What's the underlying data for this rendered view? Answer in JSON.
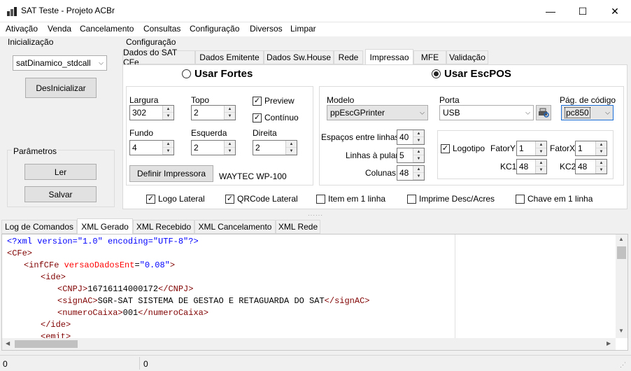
{
  "window": {
    "title": "SAT Teste - Projeto ACBr",
    "minimize": "—",
    "maximize": "☐",
    "close": "✕"
  },
  "menu": [
    "Ativação",
    "Venda",
    "Cancelamento",
    "Consultas",
    "Configuração",
    "Diversos",
    "Limpar"
  ],
  "init": {
    "title": "Inicialização",
    "lib_value": "satDinamico_stdcall",
    "deinit_label": "DesInicializar",
    "params_title": "Parâmetros",
    "read_label": "Ler",
    "save_label": "Salvar"
  },
  "config": {
    "title": "Configuração",
    "tabs": [
      "Dados do SAT CFe",
      "Dados Emitente",
      "Dados Sw.House",
      "Rede",
      "Impressao",
      "MFE",
      "Validação"
    ],
    "active_tab": "Impressao",
    "radio_fortes": "Usar Fortes",
    "radio_escpos": "Usar EscPOS",
    "selected": "Usar EscPOS",
    "fortes": {
      "largura_label": "Largura",
      "largura": "302",
      "topo_label": "Topo",
      "topo": "2",
      "fundo_label": "Fundo",
      "fundo": "4",
      "esquerda_label": "Esquerda",
      "esquerda": "2",
      "direita_label": "Direita",
      "direita": "2",
      "preview_label": "Preview",
      "preview": true,
      "continuo_label": "Contínuo",
      "continuo": true,
      "define_printer_label": "Definir Impressora",
      "printer_name": "WAYTEC WP-100"
    },
    "escpos": {
      "modelo_label": "Modelo",
      "modelo": "ppEscGPrinter",
      "porta_label": "Porta",
      "porta": "USB",
      "codepage_label": "Pág. de código",
      "codepage": "pc850",
      "espacos_label": "Espaços entre linhas",
      "espacos": "40",
      "linhas_pular_label": "Linhas à pular",
      "linhas_pular": "5",
      "colunas_label": "Colunas",
      "colunas": "48",
      "logotipo_label": "Logotipo",
      "logotipo": true,
      "fatory_label": "FatorY",
      "fatory": "1",
      "fatorx_label": "FatorX",
      "fatorx": "1",
      "kc1_label": "KC1",
      "kc1": "48",
      "kc2_label": "KC2",
      "kc2": "48"
    },
    "bottom_checks": [
      {
        "label": "Logo Lateral",
        "checked": true
      },
      {
        "label": "QRCode Lateral",
        "checked": true
      },
      {
        "label": "Item em 1 linha",
        "checked": false
      },
      {
        "label": "Imprime Desc/Acres",
        "checked": false
      },
      {
        "label": "Chave em 1 linha",
        "checked": false
      }
    ]
  },
  "log_tabs": [
    "Log de Comandos",
    "XML Gerado",
    "XML Recebido",
    "XML Cancelamento",
    "XML Rede"
  ],
  "active_log_tab": "XML Gerado",
  "xml_lines": [
    {
      "indent": 0,
      "parts": [
        [
          "pi",
          "<?xml version=\"1.0\" encoding=\"UTF-8\"?>"
        ]
      ]
    },
    {
      "indent": 0,
      "parts": [
        [
          "tg",
          "<CFe>"
        ]
      ]
    },
    {
      "indent": 1,
      "parts": [
        [
          "tg",
          "<infCFe "
        ],
        [
          "at",
          "versaoDadosEnt"
        ],
        [
          "tx",
          "="
        ],
        [
          "av",
          "\"0.08\""
        ],
        [
          "tg",
          ">"
        ]
      ]
    },
    {
      "indent": 2,
      "parts": [
        [
          "tg",
          "<ide>"
        ]
      ]
    },
    {
      "indent": 3,
      "parts": [
        [
          "tg",
          "<CNPJ>"
        ],
        [
          "tx",
          "16716114000172"
        ],
        [
          "tg",
          "</CNPJ>"
        ]
      ]
    },
    {
      "indent": 3,
      "parts": [
        [
          "tg",
          "<signAC>"
        ],
        [
          "tx",
          "SGR-SAT SISTEMA DE GESTAO E RETAGUARDA DO SAT"
        ],
        [
          "tg",
          "</signAC>"
        ]
      ]
    },
    {
      "indent": 3,
      "parts": [
        [
          "tg",
          "<numeroCaixa>"
        ],
        [
          "tx",
          "001"
        ],
        [
          "tg",
          "</numeroCaixa>"
        ]
      ]
    },
    {
      "indent": 2,
      "parts": [
        [
          "tg",
          "</ide>"
        ]
      ]
    },
    {
      "indent": 2,
      "parts": [
        [
          "tg",
          "<emit>"
        ]
      ]
    }
  ],
  "status": {
    "left": "0",
    "right": "0"
  }
}
